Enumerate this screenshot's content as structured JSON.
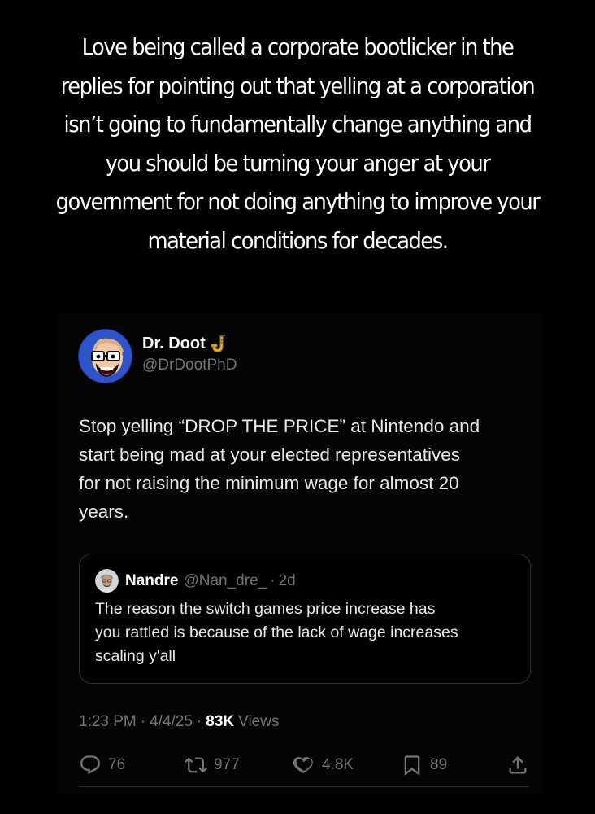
{
  "caption": {
    "lines": [
      "Love being called a corporate bootlicker in the",
      "replies for pointing out that yelling at a corporation",
      "isn’t going to fundamentally change anything and",
      "you should be turning your anger at your",
      "government for not doing anything to improve your",
      "material conditions for decades."
    ]
  },
  "tweet": {
    "display_name": "Dr. Doot",
    "handle": "@DrDootPhD",
    "name_emoji_icon": "saxophone-icon",
    "text_lines": [
      "Stop yelling “DROP THE PRICE” at Nintendo and",
      "start being mad at your elected representatives",
      "for not raising the minimum wage for almost 20",
      "years."
    ],
    "quote": {
      "display_name": "Nandre",
      "handle": "@Nan_dre_",
      "dot": "·",
      "age": "2d",
      "text_lines": [
        "The reason the switch games price increase has",
        "you rattled is because of the lack of wage increases",
        "scaling y'all"
      ]
    },
    "meta": {
      "time": "1:23 PM",
      "sep": "·",
      "date": "4/4/25",
      "views_count": "83K",
      "views_label": "Views"
    },
    "actions": {
      "replies": "76",
      "reposts": "977",
      "likes": "4.8K",
      "bookmarks": "89"
    }
  },
  "colors": {
    "background": "#000000",
    "text": "#e7e9ea",
    "muted": "#71767b",
    "border": "#2f3336"
  }
}
